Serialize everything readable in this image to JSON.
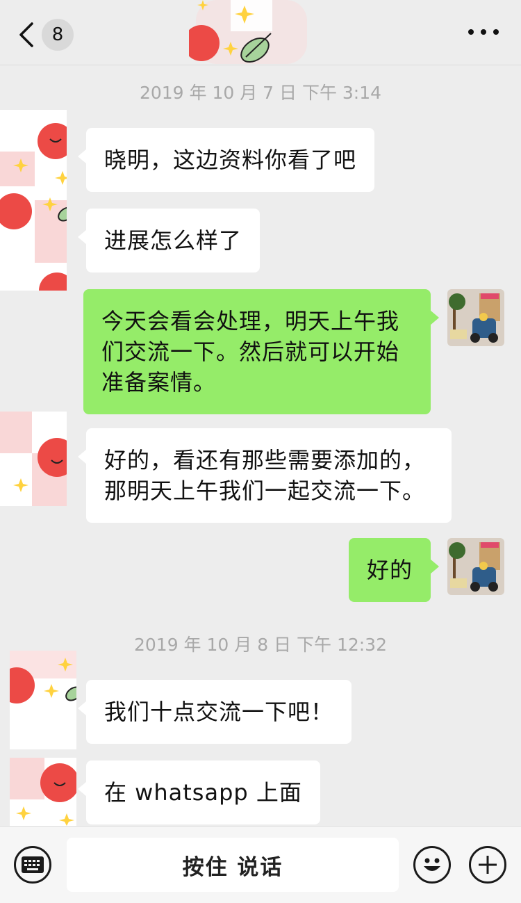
{
  "header": {
    "unread_count": "8",
    "back_icon": "chevron-left-icon",
    "more_icon": "more-dots-icon"
  },
  "messages": [
    {
      "type": "timestamp",
      "text": "2019 年 10 月 7 日  下午 3:14"
    },
    {
      "type": "in",
      "text": "晓明，这边资料你看了吧"
    },
    {
      "type": "in",
      "text": "进展怎么样了"
    },
    {
      "type": "out",
      "text": "今天会看会处理，明天上午我\n们交流一下。然后就可以开始\n准备案情。"
    },
    {
      "type": "in",
      "text": "好的，看还有那些需要添加的，\n那明天上午我们一起交流一下。"
    },
    {
      "type": "out",
      "text": "好的"
    },
    {
      "type": "timestamp",
      "text": "2019 年 10 月 8 日  下午 12:32"
    },
    {
      "type": "in",
      "text": "我们十点交流一下吧！"
    },
    {
      "type": "in",
      "text": "在 whatsapp 上面"
    }
  ],
  "input_bar": {
    "hold_to_talk_label": "按住 说话",
    "keyboard_icon": "keyboard-icon",
    "emoji_icon": "emoji-icon",
    "add_icon": "plus-icon"
  },
  "colors": {
    "background": "#ededed",
    "incoming_bubble": "#ffffff",
    "outgoing_bubble": "#95ec69",
    "timestamp": "#a8a8a8"
  }
}
